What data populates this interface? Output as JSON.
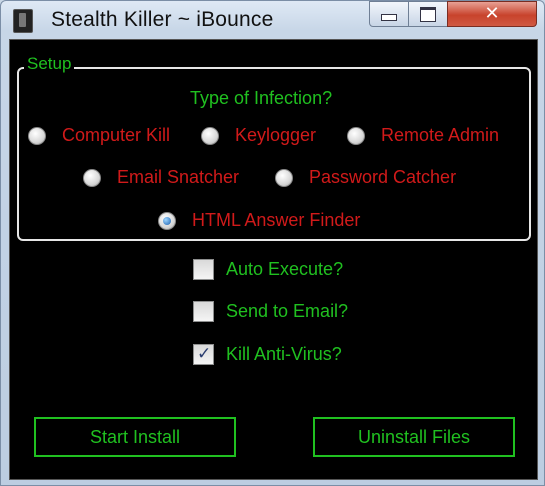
{
  "window": {
    "title": "Stealth Killer ~ iBounce"
  },
  "setup": {
    "legend": "Setup",
    "heading": "Type of Infection?",
    "options": [
      {
        "label": "Computer Kill",
        "selected": false
      },
      {
        "label": "Keylogger",
        "selected": false
      },
      {
        "label": "Remote Admin",
        "selected": false
      },
      {
        "label": "Email Snatcher",
        "selected": false
      },
      {
        "label": "Password Catcher",
        "selected": false
      },
      {
        "label": "HTML Answer Finder",
        "selected": true
      }
    ]
  },
  "checkboxes": [
    {
      "label": "Auto Execute?",
      "checked": false
    },
    {
      "label": "Send to Email?",
      "checked": false
    },
    {
      "label": "Kill Anti-Virus?",
      "checked": true
    }
  ],
  "buttons": {
    "start": "Start Install",
    "uninstall": "Uninstall Files"
  },
  "colors": {
    "background": "#000000",
    "accent_green": "#20c020",
    "option_red": "#d11a1a"
  }
}
